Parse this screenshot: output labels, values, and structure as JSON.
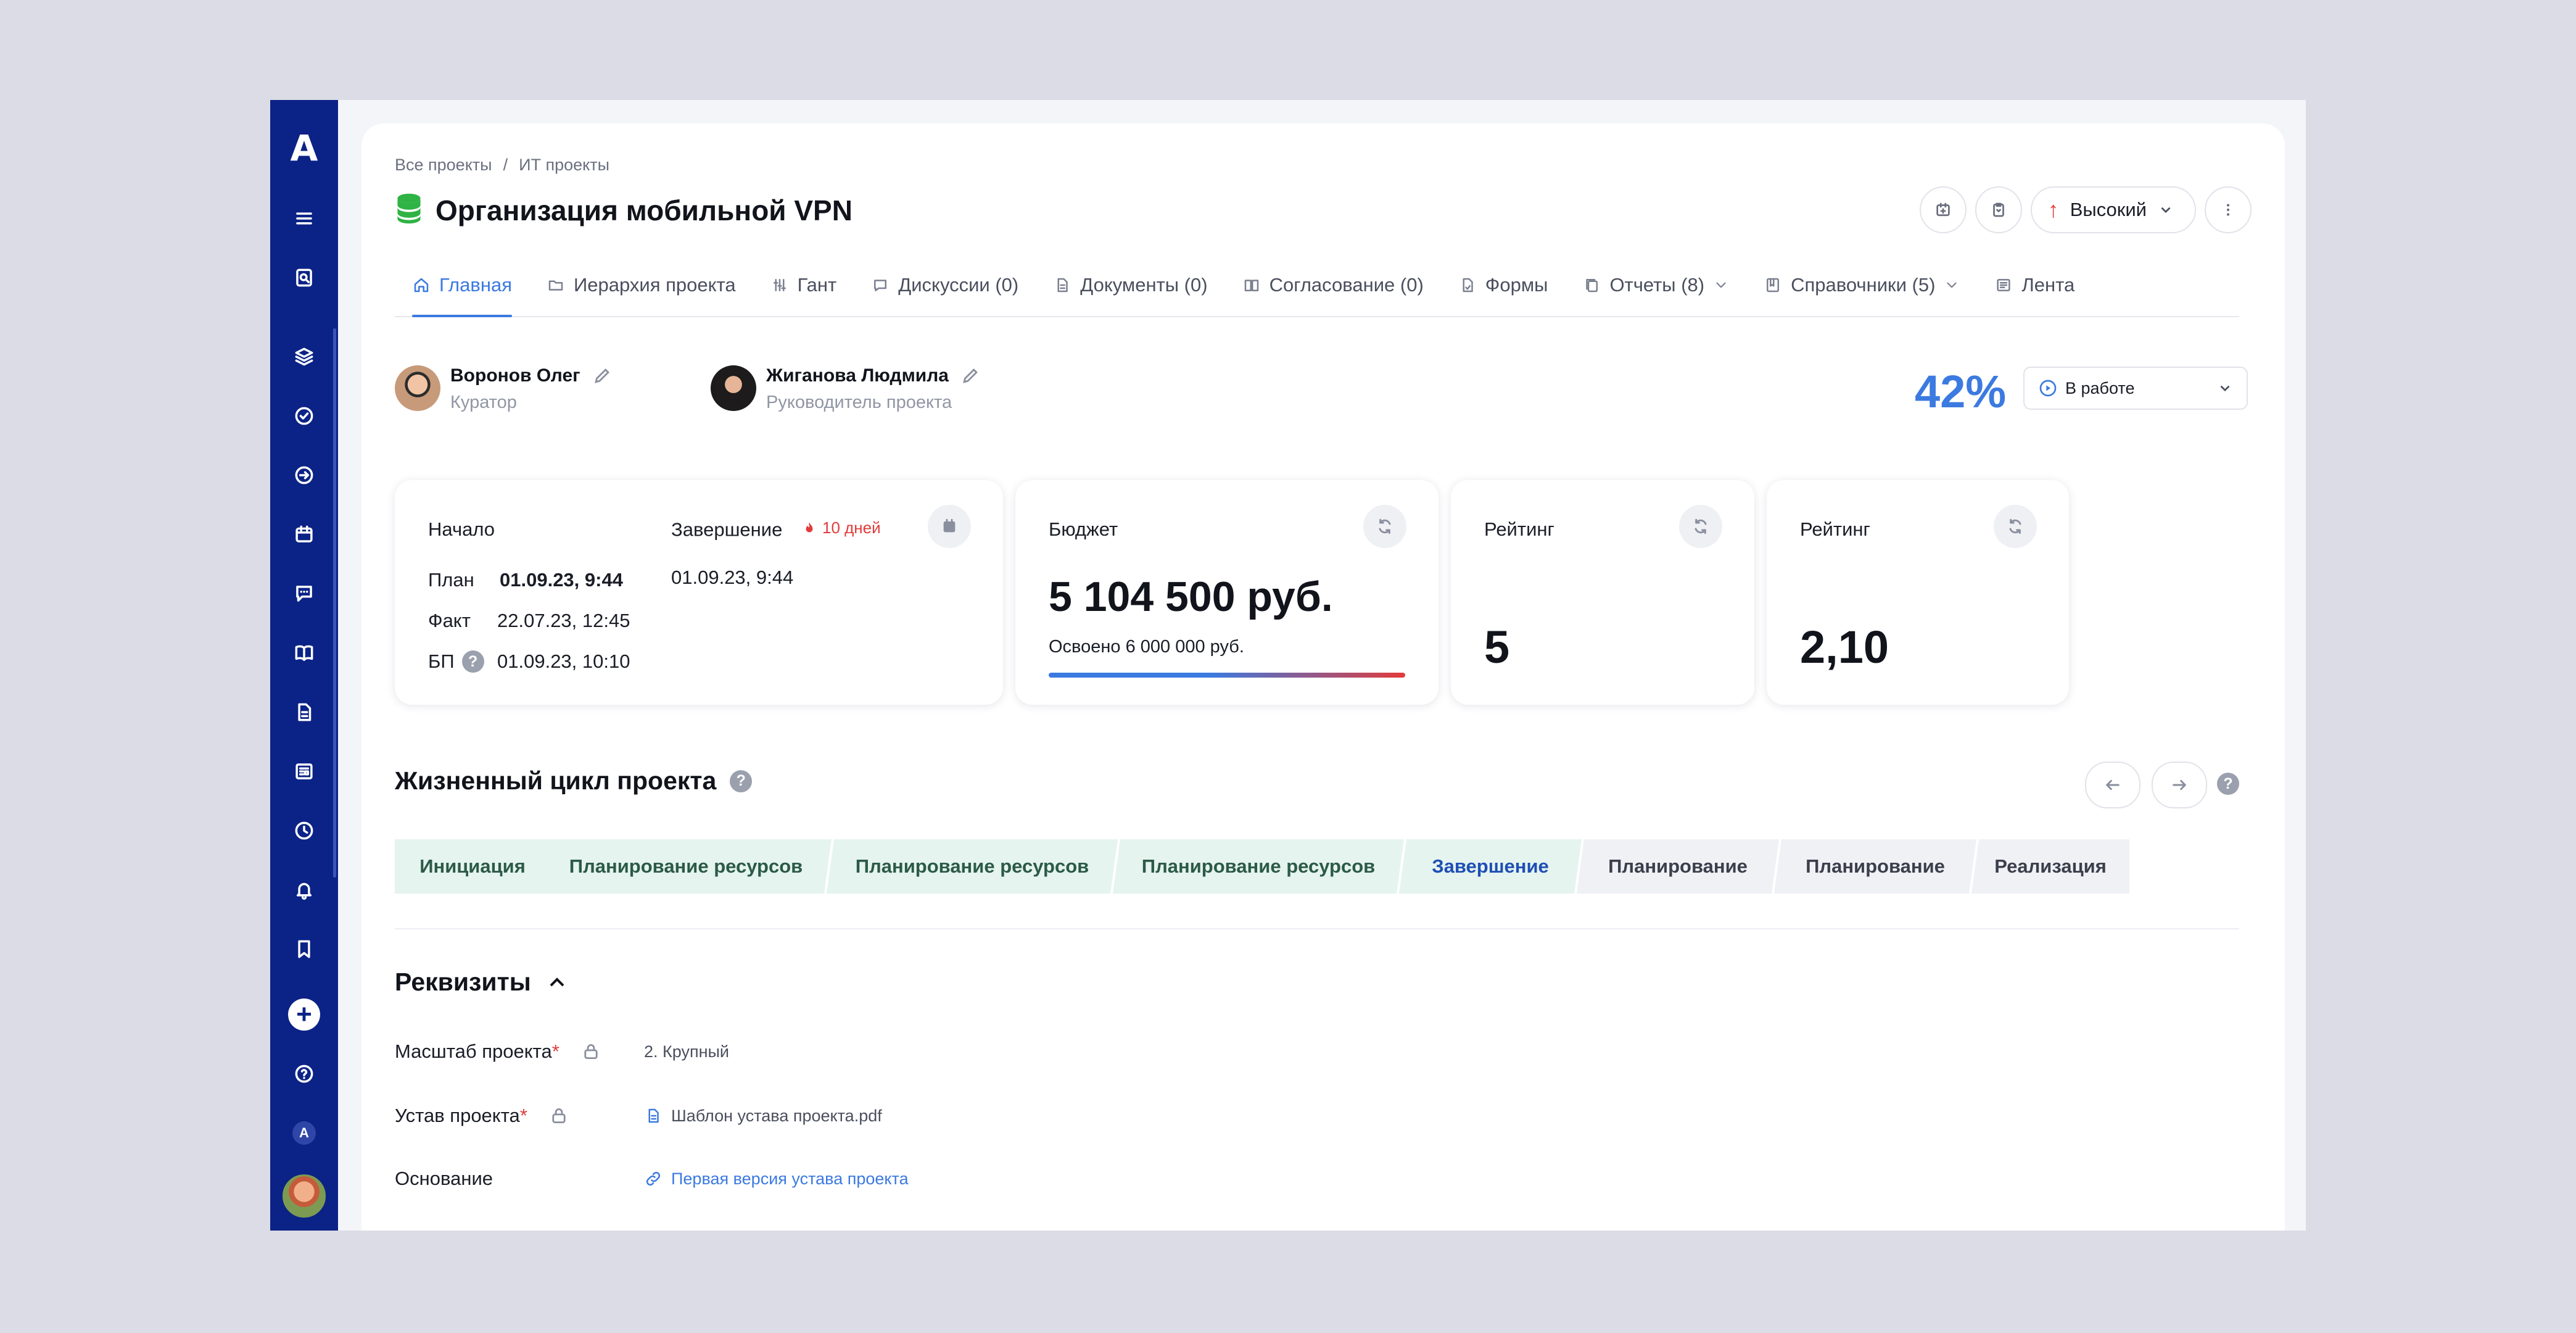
{
  "sidebar": {
    "logo": "A",
    "items": [
      "menu-icon",
      "search-document-icon",
      "layers-icon",
      "check-circle-icon",
      "arrow-right-circle-icon",
      "calendar-icon",
      "chat-icon",
      "book-icon",
      "document-icon",
      "news-icon",
      "clock-icon",
      "bell-icon",
      "bookmark-icon",
      "plus-icon",
      "help-icon",
      "account-mini-icon",
      "avatar"
    ],
    "account_mini": "A",
    "plus": "+"
  },
  "breadcrumb": {
    "root": "Все проекты",
    "separator": "/",
    "current": "ИТ проекты"
  },
  "project": {
    "title": "Организация мобильной VPN",
    "icon_color": "#2fb344"
  },
  "actions": {
    "priority_label": "Высокий",
    "priority_arrow": "↑"
  },
  "tabs": [
    {
      "label": "Главная",
      "icon": "home-icon",
      "active": true
    },
    {
      "label": "Иерархия проекта",
      "icon": "folder-icon"
    },
    {
      "label": "Гант",
      "icon": "gantt-icon"
    },
    {
      "label": "Дискуссии (0)",
      "icon": "chat-icon"
    },
    {
      "label": "Документы (0)",
      "icon": "document-icon"
    },
    {
      "label": "Согласование (0)",
      "icon": "book-icon"
    },
    {
      "label": "Формы",
      "icon": "form-icon"
    },
    {
      "label": "Отчеты (8)",
      "icon": "copy-icon",
      "dropdown": true
    },
    {
      "label": "Справочники (5)",
      "icon": "directory-icon",
      "dropdown": true
    },
    {
      "label": "Лента",
      "icon": "news-icon"
    }
  ],
  "people": [
    {
      "name": "Воронов Олег",
      "role": "Куратор"
    },
    {
      "name": "Жиганова Людмила",
      "role": "Руководитель проекта"
    }
  ],
  "progress": {
    "percent_text": "42%",
    "status": "В работе"
  },
  "dates": {
    "start_title": "Начало",
    "end_title": "Завершение",
    "deadline": "10 дней",
    "rows": [
      {
        "label": "План",
        "start": "01.09.23, 9:44",
        "end": "01.09.23, 9:44"
      },
      {
        "label": "Факт",
        "start": "22.07.23, 12:45"
      },
      {
        "label": "БП",
        "start": "01.09.23, 10:10"
      }
    ]
  },
  "budget": {
    "title": "Бюджет",
    "amount": "5 104 500 руб.",
    "spent": "Освоено 6 000 000 руб."
  },
  "ratings": [
    {
      "title": "Рейтинг",
      "value": "5"
    },
    {
      "title": "Рейтинг",
      "value": "2,10"
    }
  ],
  "lifecycle": {
    "title": "Жизненный цикл проекта",
    "help": "?",
    "stages": [
      {
        "label": "Инициация",
        "state": "done"
      },
      {
        "label": "Планирование ресурсов",
        "state": "done"
      },
      {
        "label": "Планирование ресурсов",
        "state": "done"
      },
      {
        "label": "Планирование ресурсов",
        "state": "done"
      },
      {
        "label": "Завершение",
        "state": "current"
      },
      {
        "label": "Планирование",
        "state": "todo"
      },
      {
        "label": "Планирование",
        "state": "todo"
      },
      {
        "label": "Реализация",
        "state": "todo"
      }
    ]
  },
  "requisites": {
    "title": "Реквизиты",
    "rows": [
      {
        "label": "Масштаб проекта",
        "required": "*",
        "locked": true,
        "value": "2. Крупный",
        "type": "text"
      },
      {
        "label": "Устав проекта",
        "required": "*",
        "locked": true,
        "value": "Шаблон устава проекта.pdf",
        "type": "file"
      },
      {
        "label": "Основание",
        "required": "",
        "locked": false,
        "value": "Первая версия устава проекта",
        "type": "link"
      }
    ]
  },
  "colors": {
    "sidebar": "#0b2386",
    "accent": "#3b7ae0",
    "danger": "#e23b3b",
    "stage_done_bg": "#e5f4ee"
  }
}
